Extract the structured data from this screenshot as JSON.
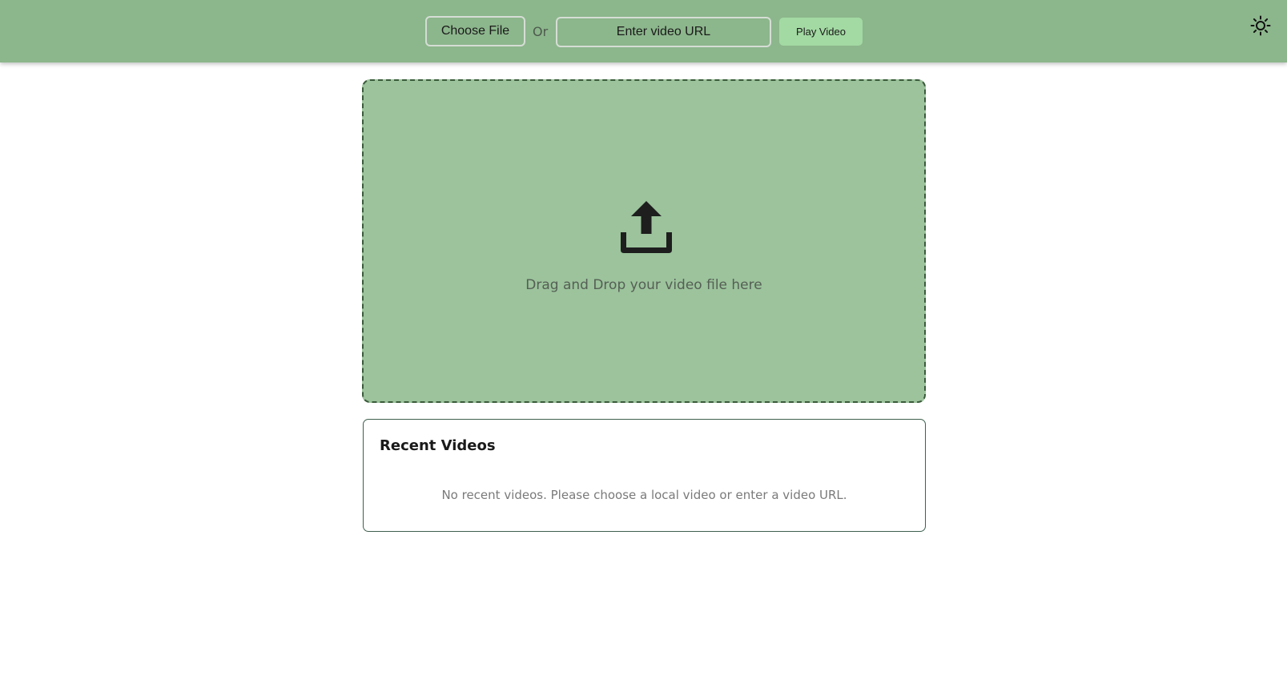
{
  "header": {
    "choose_file_label": "Choose File",
    "or_label": "Or",
    "url_placeholder": "Enter video URL",
    "play_button_label": "Play Video",
    "theme_toggle_icon": "sun-icon"
  },
  "dropzone": {
    "icon": "upload-icon",
    "text": "Drag and Drop your video file here"
  },
  "recent_videos": {
    "title": "Recent Videos",
    "empty_message": "No recent videos. Please choose a local video or enter a video URL."
  },
  "colors": {
    "header_bg": "#8cb68c",
    "dropzone_bg": "#9cc39c",
    "play_button_bg": "#a3d9a3"
  }
}
